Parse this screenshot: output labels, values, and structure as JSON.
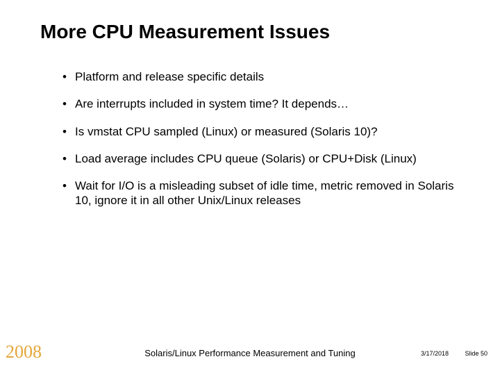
{
  "title": "More CPU Measurement Issues",
  "bullets": [
    "Platform and release specific details",
    "Are interrupts included in system time? It depends…",
    "Is vmstat CPU sampled (Linux) or measured (Solaris 10)?",
    "Load average includes CPU queue (Solaris) or CPU+Disk (Linux)",
    "Wait for I/O is a misleading subset of idle time, metric removed in Solaris 10, ignore it in all other Unix/Linux releases"
  ],
  "footer": {
    "year": "2008",
    "center": "Solaris/Linux Performance Measurement and Tuning",
    "date": "3/17/2018",
    "slide": "Slide 50"
  }
}
